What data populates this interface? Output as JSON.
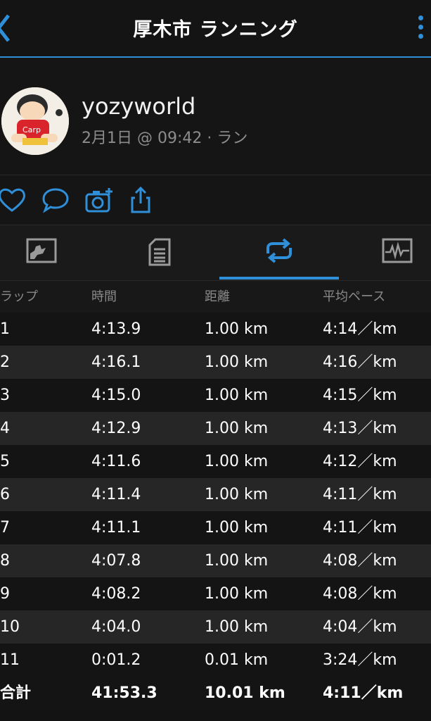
{
  "header": {
    "title": "厚木市 ランニング"
  },
  "profile": {
    "username": "yozyworld",
    "meta": "2月1日 @ 09:42 · ラン"
  },
  "actions": [
    {
      "name": "like-heart-icon"
    },
    {
      "name": "comment-icon"
    },
    {
      "name": "add-photo-icon"
    },
    {
      "name": "share-icon"
    }
  ],
  "tabs": [
    {
      "name": "chart-icon",
      "active": false
    },
    {
      "name": "details-icon",
      "active": false
    },
    {
      "name": "laps-icon",
      "active": true
    },
    {
      "name": "stats-icon",
      "active": false
    }
  ],
  "colors": {
    "accent": "#2f8fd8",
    "background": "#131313",
    "row_alt": "#262626"
  },
  "table": {
    "headers": [
      "ラップ",
      "時間",
      "距離",
      "平均ペース"
    ],
    "rows": [
      [
        "1",
        "4:13.9",
        "1.00 km",
        "4:14／km"
      ],
      [
        "2",
        "4:16.1",
        "1.00 km",
        "4:16／km"
      ],
      [
        "3",
        "4:15.0",
        "1.00 km",
        "4:15／km"
      ],
      [
        "4",
        "4:12.9",
        "1.00 km",
        "4:13／km"
      ],
      [
        "5",
        "4:11.6",
        "1.00 km",
        "4:12／km"
      ],
      [
        "6",
        "4:11.4",
        "1.00 km",
        "4:11／km"
      ],
      [
        "7",
        "4:11.1",
        "1.00 km",
        "4:11／km"
      ],
      [
        "8",
        "4:07.8",
        "1.00 km",
        "4:08／km"
      ],
      [
        "9",
        "4:08.2",
        "1.00 km",
        "4:08／km"
      ],
      [
        "10",
        "4:04.0",
        "1.00 km",
        "4:04／km"
      ],
      [
        "11",
        "0:01.2",
        "0.01 km",
        "3:24／km"
      ]
    ],
    "total": [
      "合計",
      "41:53.3",
      "10.01 km",
      "4:11／km"
    ]
  }
}
